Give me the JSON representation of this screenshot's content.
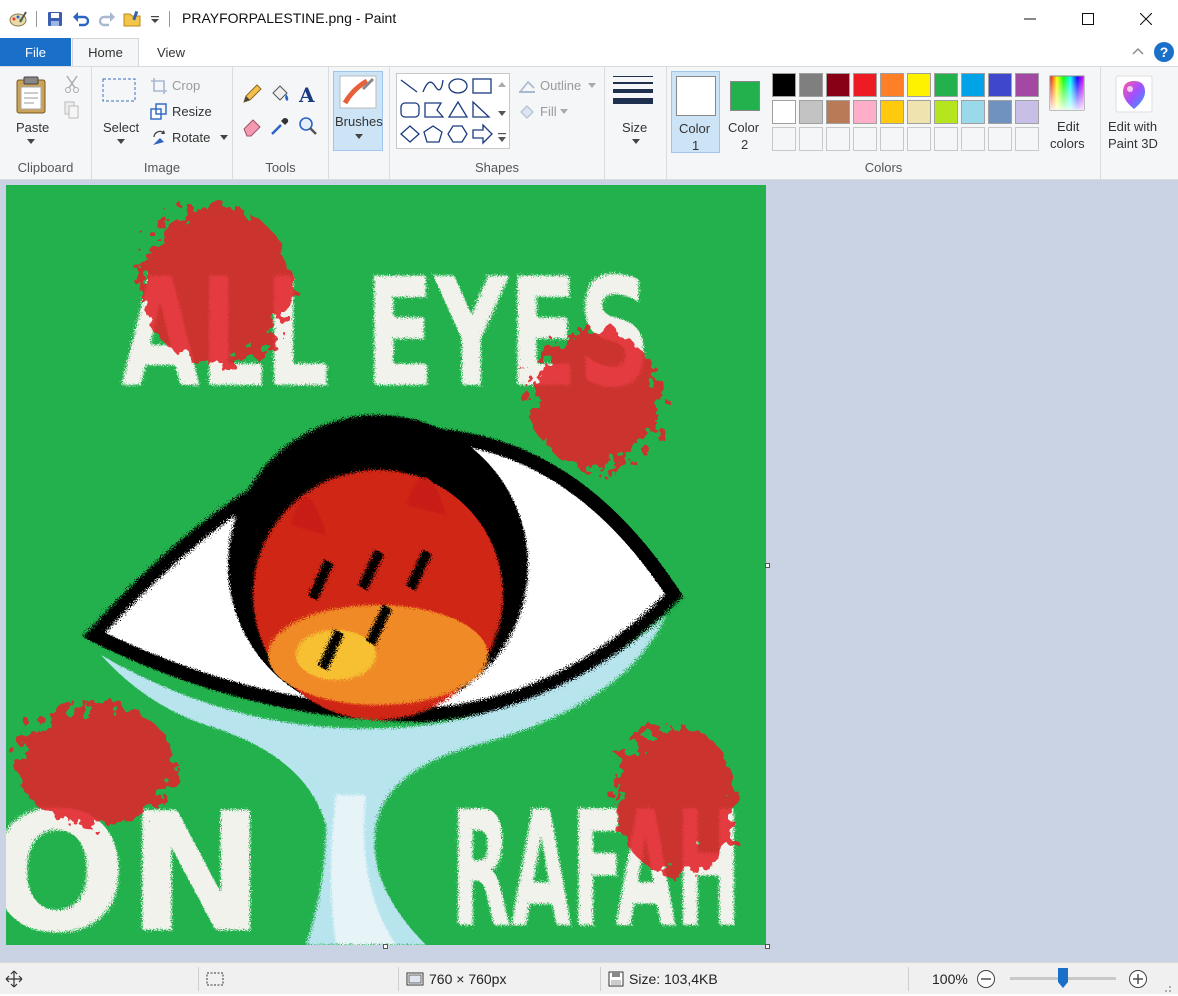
{
  "window": {
    "title": "PRAYFORPALESTINE.png - Paint"
  },
  "tabs": {
    "file": "File",
    "home": "Home",
    "view": "View"
  },
  "help_label": "?",
  "ribbon": {
    "clipboard": {
      "paste": "Paste",
      "group": "Clipboard"
    },
    "image": {
      "select": "Select",
      "crop": "Crop",
      "resize": "Resize",
      "rotate": "Rotate",
      "group": "Image"
    },
    "tools": {
      "group": "Tools"
    },
    "brushes": {
      "label": "Brushes"
    },
    "shapes": {
      "outline": "Outline",
      "fill": "Fill",
      "group": "Shapes"
    },
    "size": {
      "label": "Size"
    },
    "colors": {
      "color1_label": "Color",
      "color1_num": "1",
      "color2_label": "Color",
      "color2_num": "2",
      "color1_value": "#ffffff",
      "color2_value": "#22b14c",
      "edit_colors_line1": "Edit",
      "edit_colors_line2": "colors",
      "group": "Colors",
      "palette_row1": [
        "#000000",
        "#7f7f7f",
        "#880015",
        "#ed1c24",
        "#ff7f27",
        "#fff200",
        "#22b14c",
        "#00a2e8",
        "#3f48cc",
        "#a349a4"
      ],
      "palette_row2": [
        "#ffffff",
        "#c3c3c3",
        "#b97a57",
        "#ffaec9",
        "#ffc90e",
        "#efe4b0",
        "#b5e61d",
        "#99d9ea",
        "#7092be",
        "#c8bfe7"
      ]
    },
    "paint3d": {
      "line1": "Edit with",
      "line2": "Paint 3D"
    }
  },
  "canvas_art": {
    "background": "#22b14c",
    "text_top": "ALL EYES",
    "text_bottom_left": "ON",
    "text_bottom_right": "RAFAH"
  },
  "status": {
    "dimensions": "760 × 760px",
    "size": "Size: 103,4KB",
    "zoom": "100%"
  }
}
